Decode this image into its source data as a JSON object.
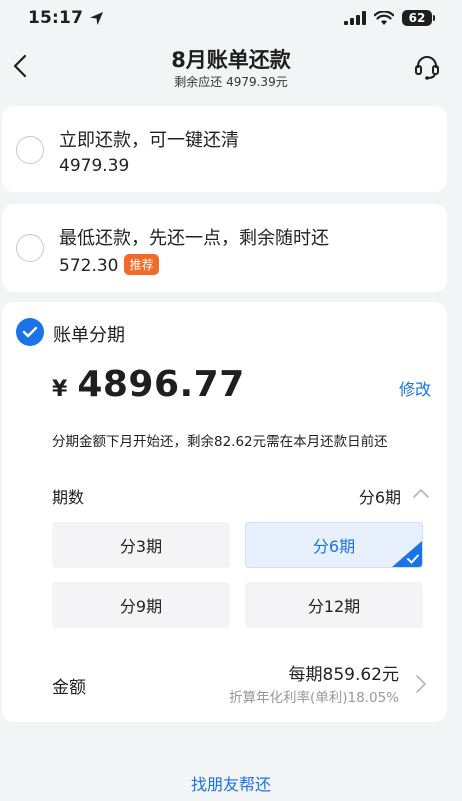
{
  "status_bar": {
    "time": "15:17",
    "battery": "62"
  },
  "header": {
    "title": "8月账单还款",
    "subtitle": "剩余应还 4979.39元"
  },
  "options": [
    {
      "title": "立即还款，可一键还清",
      "amount": "4979.39"
    },
    {
      "title": "最低还款，先还一点，剩余随时还",
      "amount": "572.30",
      "tag": "推荐"
    }
  ],
  "installment": {
    "title": "账单分期",
    "currency": "¥",
    "amount": "4896.77",
    "edit_label": "修改",
    "note": "分期金额下月开始还，剩余82.62元需在本月还款日前还",
    "period_label": "期数",
    "period_value": "分6期",
    "period_options": [
      "分3期",
      "分6期",
      "分9期",
      "分12期"
    ],
    "selected_period": "分6期",
    "amount_label": "金额",
    "per_period": "每期859.62元",
    "rate": "折算年化利率(单利)18.05%"
  },
  "footer": {
    "help_link": "找朋友帮还"
  },
  "colors": {
    "accent": "#1a73e8",
    "tag": "#f26a2a",
    "background": "#f3f4f6"
  }
}
